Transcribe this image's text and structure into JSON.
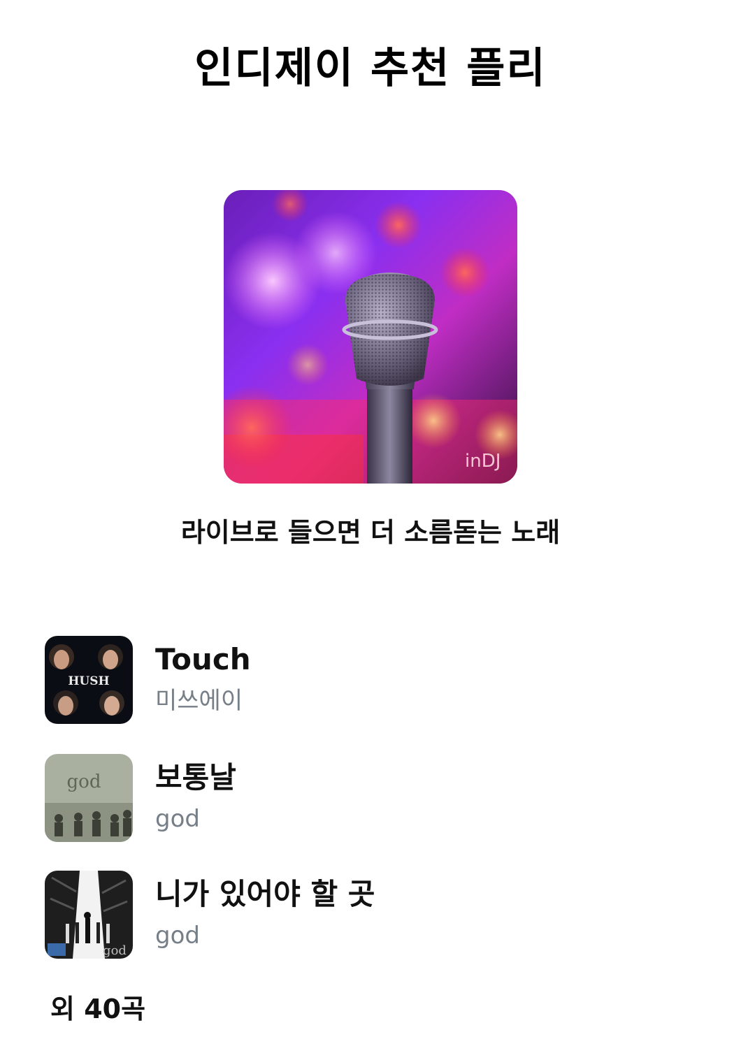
{
  "header": {
    "title": "인디제이 추천 플리"
  },
  "cover": {
    "watermark": "inDJ",
    "icon": "microphone-cover-image"
  },
  "playlist": {
    "description": "라이브로 들으면 더 소름돋는 노래",
    "tracks": [
      {
        "title": "Touch",
        "artist": "미쓰에이",
        "art_text": "HUSH"
      },
      {
        "title": "보통날",
        "artist": "god",
        "art_text": "god"
      },
      {
        "title": "니가 있어야 할 곳",
        "artist": "god",
        "art_text": "god"
      }
    ],
    "more_label": "외 40곡"
  },
  "colors": {
    "artist_text": "#767e88",
    "title_text": "#111111"
  }
}
